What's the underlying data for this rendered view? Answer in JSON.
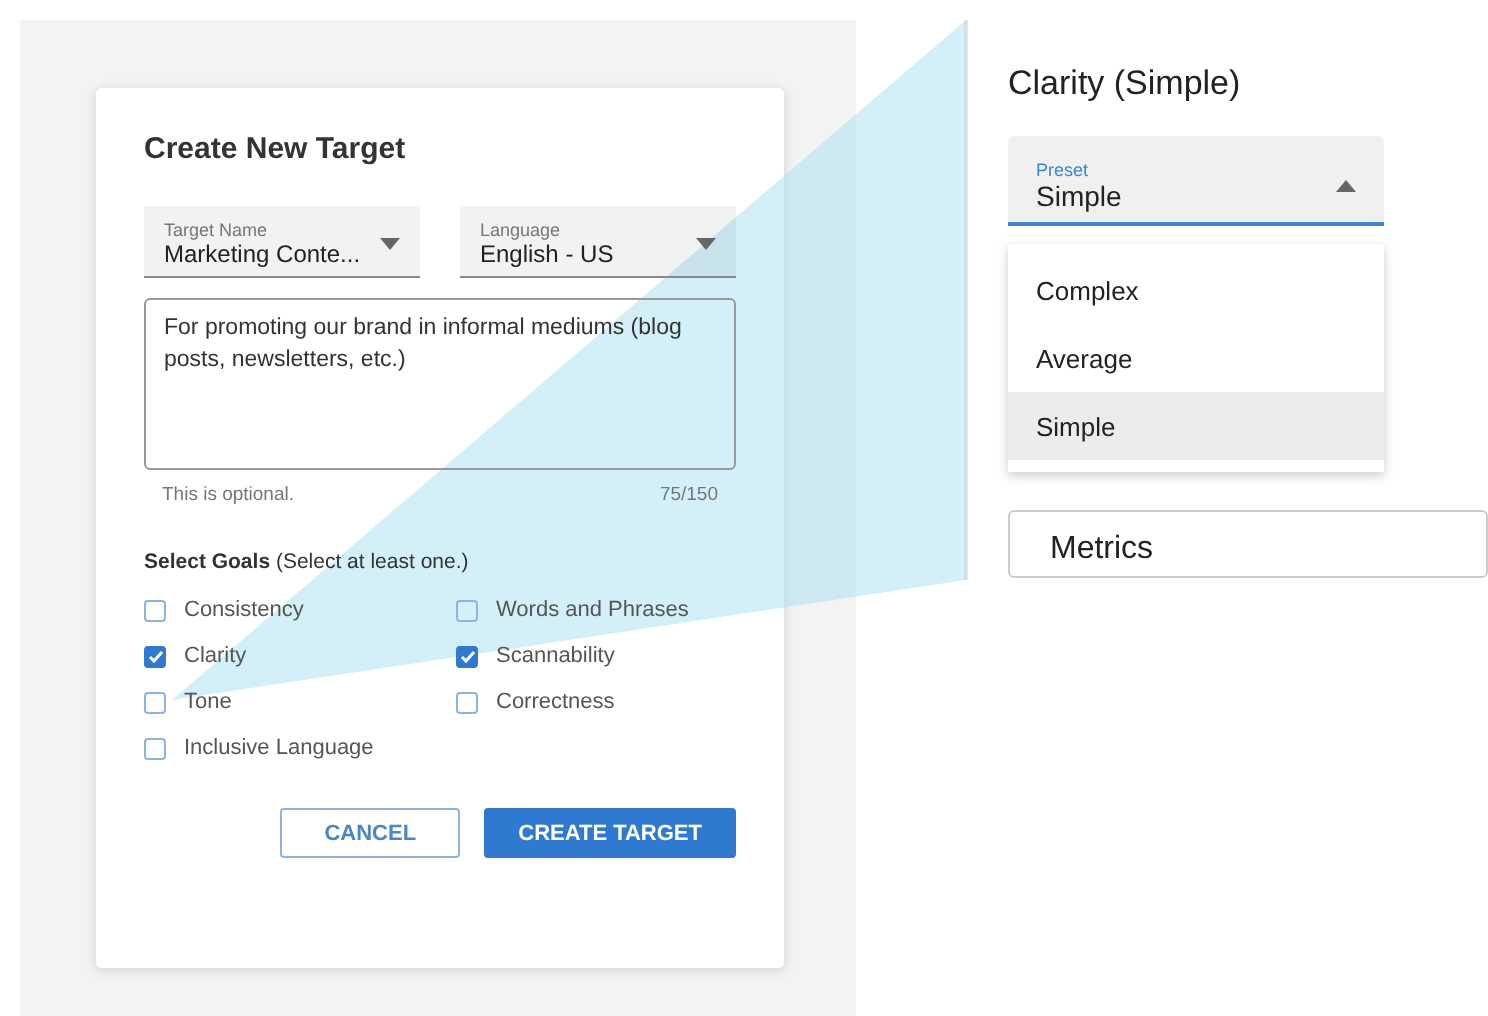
{
  "dialog": {
    "title": "Create New Target",
    "target_name": {
      "label": "Target Name",
      "value": "Marketing Conte..."
    },
    "language": {
      "label": "Language",
      "value": "English - US"
    },
    "description": {
      "value": "For promoting our brand in informal mediums (blog posts, newsletters, etc.)",
      "helper": "This is optional.",
      "counter": "75/150"
    },
    "goals_heading": "**Select Goals** (Select at least one.)",
    "goals": [
      {
        "label": "Consistency",
        "checked": false
      },
      {
        "label": "Words and Phrases",
        "checked": false
      },
      {
        "label": "Clarity",
        "checked": true
      },
      {
        "label": "Scannability",
        "checked": true
      },
      {
        "label": "Tone",
        "checked": false
      },
      {
        "label": "Correctness",
        "checked": false
      },
      {
        "label": "Inclusive Language",
        "checked": false
      }
    ],
    "buttons": [
      {
        "label": "CANCEL",
        "kind": "outlined"
      },
      {
        "label": "CREATE TARGET",
        "kind": "primary"
      }
    ]
  },
  "callout": {
    "title": "Clarity (Simple)",
    "preset": {
      "label": "Preset",
      "value": "Simple",
      "expanded": true
    },
    "options": [
      {
        "label": "Complex",
        "selected": false
      },
      {
        "label": "Average",
        "selected": false
      },
      {
        "label": "Simple",
        "selected": true
      }
    ],
    "card_title": "Metrics"
  }
}
